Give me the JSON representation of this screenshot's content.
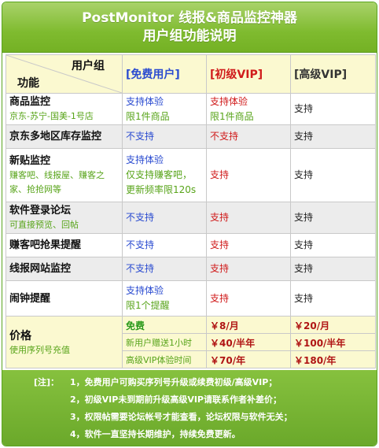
{
  "banner": {
    "title": "PostMonitor 线报&商品监控神器",
    "subtitle": "用户组功能说明"
  },
  "header": {
    "corner_top": "用户组",
    "corner_bottom": "功能",
    "plan_free": "[免费用户]",
    "plan_junior": "[初级VIP]",
    "plan_senior": "[高级VIP]"
  },
  "rows": [
    {
      "name": "商品监控",
      "sub": "京东-苏宁-国美-1号店",
      "free": [
        "支持体验",
        "限1件商品"
      ],
      "junior": [
        "支持体验",
        "限1件商品"
      ],
      "senior": "支持"
    },
    {
      "name": "京东多地区库存监控",
      "sub": "",
      "free": [
        "不支持"
      ],
      "junior": [
        "不支持"
      ],
      "senior": "支持"
    },
    {
      "name": "新贴监控",
      "sub": "赚客吧、线报屋、赚客之家、抢抢网等",
      "free": [
        "支持体验",
        "仅支持赚客吧，",
        "更新频率限120s"
      ],
      "junior": [
        "支持"
      ],
      "senior": "支持"
    },
    {
      "name": "软件登录论坛",
      "sub": "可直接预览、回帖",
      "free": [
        "不支持"
      ],
      "junior": [
        "支持"
      ],
      "senior": "支持"
    },
    {
      "name": "赚客吧抢果提醒",
      "sub": "",
      "free": [
        "不支持"
      ],
      "junior": [
        "支持"
      ],
      "senior": "支持"
    },
    {
      "name": "线报网站监控",
      "sub": "",
      "free": [
        "不支持"
      ],
      "junior": [
        "支持"
      ],
      "senior": "支持"
    },
    {
      "name": "闹钟提醒",
      "sub": "",
      "free": [
        "支持体验",
        "限1个提醒"
      ],
      "junior": [
        "支持"
      ],
      "senior": "支持"
    }
  ],
  "pricing": {
    "label": "价格",
    "sub": "使用序列号充值",
    "free_tier": "免费",
    "gift_text": "新用户赠送1小时",
    "trial_text": "高级VIP体验时间",
    "junior_month": "￥8/月",
    "senior_month": "￥20/月",
    "junior_half": "￥40/半年",
    "senior_half": "￥100/半年",
    "junior_year": "￥70/年",
    "senior_year": "￥180/年"
  },
  "notes": {
    "label": "[注]：",
    "items": [
      "1，免费用户可购买序列号升级或续费初级/高级VIP；",
      "2，初级VIP未到期前升级高级VIP请联系作者补差价；",
      "3，权限帖需要论坛帐号才能查看，论坛权限与软件无关；",
      "4，软件一直坚持长期维护，持续免费更新。"
    ]
  },
  "colors": {
    "banner_green": "#7fbb2f",
    "header_yellow": "#fbf9d0",
    "row_gray": "#ececec",
    "free_blue": "#2a4bd0",
    "junior_red": "#d01b1b",
    "sub_green": "#58a41a",
    "price_red": "#b01414"
  }
}
